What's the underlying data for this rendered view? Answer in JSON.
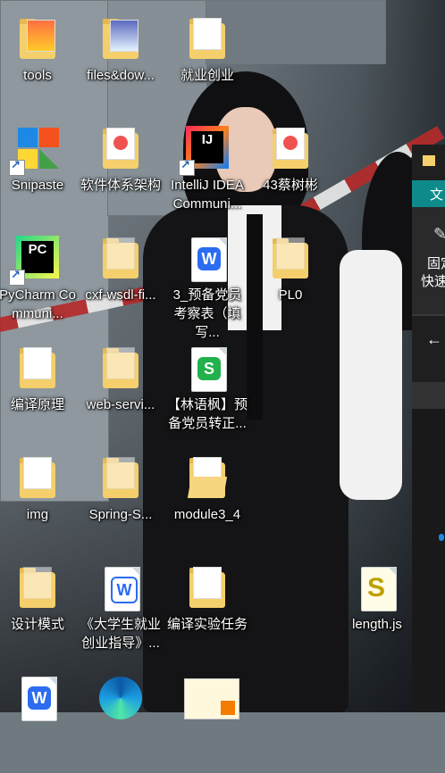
{
  "desktop": {
    "icons": [
      {
        "label": "tools",
        "type": "folder-red"
      },
      {
        "label": "files&dow...",
        "type": "folder-blue"
      },
      {
        "label": "就业创业",
        "type": "folder-doc"
      },
      {
        "label": "Snipaste",
        "type": "snipaste",
        "shortcut": true
      },
      {
        "label": "软件体系架构",
        "type": "folder-pdf"
      },
      {
        "label": "IntelliJ IDEA Communi...",
        "type": "intellij",
        "shortcut": true
      },
      {
        "label": "43蔡树彬",
        "type": "folder-pdf"
      },
      {
        "label": "PyCharm Communi...",
        "type": "pycharm",
        "shortcut": true
      },
      {
        "label": "cxf-wsdl-fi...",
        "type": "folder"
      },
      {
        "label": "3_预备党员考察表（填写...",
        "type": "wps-writer"
      },
      {
        "label": "PL0",
        "type": "folder"
      },
      {
        "label": "编译原理",
        "type": "folder-doc"
      },
      {
        "label": "web-servi...",
        "type": "folder"
      },
      {
        "label": "【林语枫】预备党员转正...",
        "type": "wps-sheet"
      },
      {
        "label": "img",
        "type": "folder-doc"
      },
      {
        "label": "Spring-S...",
        "type": "folder"
      },
      {
        "label": "module3_4",
        "type": "folder-open"
      },
      {
        "label": "设计模式",
        "type": "folder"
      },
      {
        "label": "《大学生就业创业指导》...",
        "type": "wps-writer-outline"
      },
      {
        "label": "编译实验任务",
        "type": "folder-doc"
      },
      {
        "label": "length.js",
        "type": "js"
      },
      {
        "label": "",
        "type": "wps-writer"
      },
      {
        "label": "",
        "type": "edge"
      },
      {
        "label": "",
        "type": "image"
      }
    ]
  },
  "side_window": {
    "title_glyph": "▮",
    "tab": "文",
    "pin_label_1": "固定",
    "pin_label_2": "快速",
    "back_glyph": "←"
  },
  "colors": {
    "folder": "#f5cf6b",
    "wps_blue": "#2b6cf0",
    "wps_green": "#22b14c",
    "teal": "#0f8a8a"
  }
}
